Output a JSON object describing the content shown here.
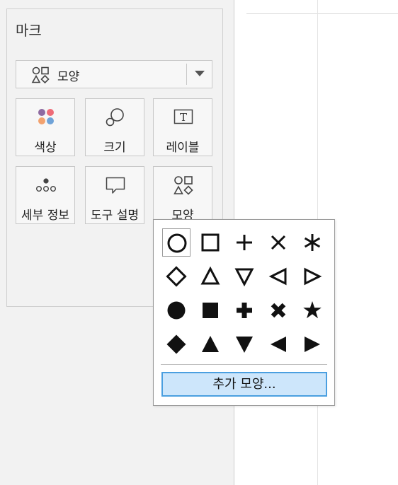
{
  "marks": {
    "title": "마크",
    "mark_type": {
      "selected": "모양",
      "icon": "shapes-icon"
    },
    "properties": [
      {
        "label": "색상",
        "icon": "color-icon"
      },
      {
        "label": "크기",
        "icon": "size-icon"
      },
      {
        "label": "레이블",
        "icon": "label-icon",
        "icon_text": "T"
      },
      {
        "label": "세부 정보",
        "icon": "detail-icon"
      },
      {
        "label": "도구 설명",
        "icon": "tooltip-icon"
      },
      {
        "label": "모양",
        "icon": "shapes-icon"
      }
    ],
    "color_swatches": [
      "#8e6aa1",
      "#ee6c78",
      "#f2a26f",
      "#6fa3d8"
    ]
  },
  "shape_popup": {
    "shapes": [
      "open-circle",
      "open-square",
      "plus",
      "cross",
      "asterisk",
      "open-diamond",
      "open-triangle-up",
      "open-triangle-down",
      "open-triangle-left",
      "open-triangle-right",
      "filled-circle",
      "filled-square",
      "filled-plus",
      "filled-cross",
      "filled-star",
      "filled-diamond",
      "filled-triangle-up",
      "filled-triangle-down",
      "filled-triangle-left",
      "filled-triangle-right"
    ],
    "selected_index": 0,
    "more_button": "추가 모양..."
  },
  "colors": {
    "accent": "#4a9fe0",
    "highlight": "#cde6fb"
  }
}
